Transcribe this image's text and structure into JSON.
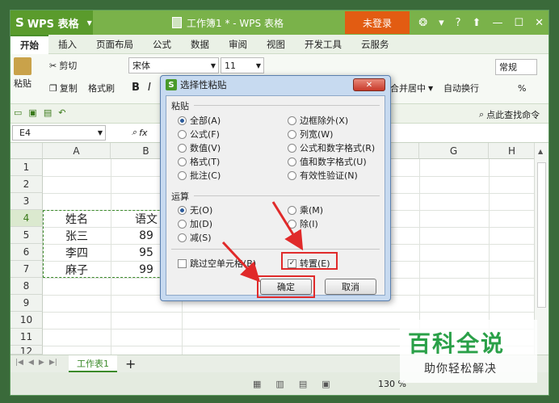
{
  "app": {
    "name": "WPS 表格",
    "doc_title": "工作簿1 * - WPS 表格",
    "login_label": "未登录",
    "help": "?"
  },
  "menu_tabs": [
    "开始",
    "插入",
    "页面布局",
    "公式",
    "数据",
    "审阅",
    "视图",
    "开发工具",
    "云服务"
  ],
  "ribbon": {
    "paste": "粘贴",
    "cut": "剪切",
    "copy": "复制",
    "format_painter": "格式刷",
    "font_name": "宋体",
    "font_size": "11",
    "bold": "B",
    "italic": "I",
    "merge_center": "合并居中",
    "wrap_text": "自动换行",
    "number_format": "常规",
    "percent": "%"
  },
  "quickbar": {
    "find_command": "点此查找命令"
  },
  "formula_bar": {
    "cell_ref": "E4",
    "fx": "fx"
  },
  "columns": [
    "A",
    "B",
    "G",
    "H"
  ],
  "rows": [
    "1",
    "2",
    "3",
    "4",
    "5",
    "6",
    "7",
    "8",
    "9",
    "10",
    "11",
    "12"
  ],
  "cells": [
    {
      "name": "姓名",
      "score": "语文"
    },
    {
      "name": "张三",
      "score": "89"
    },
    {
      "name": "李四",
      "score": "95"
    },
    {
      "name": "麻子",
      "score": "99"
    }
  ],
  "sheet_tabs": {
    "active": "工作表1",
    "add": "+"
  },
  "statusbar": {
    "zoom": "130 %"
  },
  "dialog": {
    "title": "选择性粘贴",
    "paste_group": "粘贴",
    "paste_options": [
      "全部(A)",
      "公式(F)",
      "数值(V)",
      "格式(T)",
      "批注(C)"
    ],
    "paste_options_right": [
      "边框除外(X)",
      "列宽(W)",
      "公式和数字格式(R)",
      "值和数字格式(U)",
      "有效性验证(N)"
    ],
    "operation_group": "运算",
    "operation_options": [
      "无(O)",
      "加(D)",
      "减(S)"
    ],
    "operation_options_right": [
      "乘(M)",
      "除(I)"
    ],
    "skip_blanks": "跳过空单元格(B)",
    "transpose": "转置(E)",
    "ok": "确定",
    "cancel": "取消",
    "selected_paste": "全部(A)",
    "selected_operation": "无(O)",
    "transpose_checked": true
  },
  "watermark": {
    "title": "百科全说",
    "subtitle": "助你轻松解决"
  },
  "colors": {
    "title_green": "#7ab24a",
    "accent_green": "#3b8a2a",
    "highlight_red": "#e02a2a",
    "login_orange": "#e25c12"
  }
}
